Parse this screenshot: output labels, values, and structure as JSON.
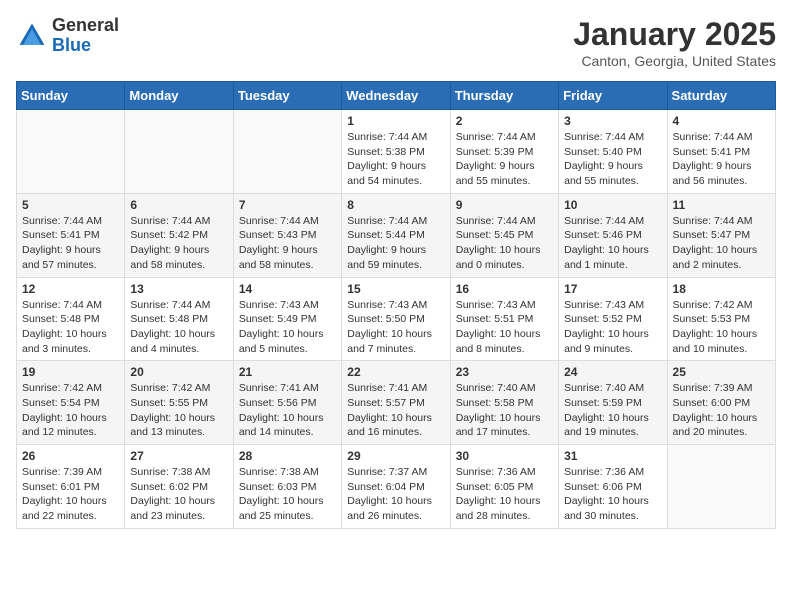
{
  "header": {
    "logo_general": "General",
    "logo_blue": "Blue",
    "month_title": "January 2025",
    "location": "Canton, Georgia, United States"
  },
  "days_of_week": [
    "Sunday",
    "Monday",
    "Tuesday",
    "Wednesday",
    "Thursday",
    "Friday",
    "Saturday"
  ],
  "weeks": [
    [
      {
        "day": "",
        "info": ""
      },
      {
        "day": "",
        "info": ""
      },
      {
        "day": "",
        "info": ""
      },
      {
        "day": "1",
        "info": "Sunrise: 7:44 AM\nSunset: 5:38 PM\nDaylight: 9 hours\nand 54 minutes."
      },
      {
        "day": "2",
        "info": "Sunrise: 7:44 AM\nSunset: 5:39 PM\nDaylight: 9 hours\nand 55 minutes."
      },
      {
        "day": "3",
        "info": "Sunrise: 7:44 AM\nSunset: 5:40 PM\nDaylight: 9 hours\nand 55 minutes."
      },
      {
        "day": "4",
        "info": "Sunrise: 7:44 AM\nSunset: 5:41 PM\nDaylight: 9 hours\nand 56 minutes."
      }
    ],
    [
      {
        "day": "5",
        "info": "Sunrise: 7:44 AM\nSunset: 5:41 PM\nDaylight: 9 hours\nand 57 minutes."
      },
      {
        "day": "6",
        "info": "Sunrise: 7:44 AM\nSunset: 5:42 PM\nDaylight: 9 hours\nand 58 minutes."
      },
      {
        "day": "7",
        "info": "Sunrise: 7:44 AM\nSunset: 5:43 PM\nDaylight: 9 hours\nand 58 minutes."
      },
      {
        "day": "8",
        "info": "Sunrise: 7:44 AM\nSunset: 5:44 PM\nDaylight: 9 hours\nand 59 minutes."
      },
      {
        "day": "9",
        "info": "Sunrise: 7:44 AM\nSunset: 5:45 PM\nDaylight: 10 hours\nand 0 minutes."
      },
      {
        "day": "10",
        "info": "Sunrise: 7:44 AM\nSunset: 5:46 PM\nDaylight: 10 hours\nand 1 minute."
      },
      {
        "day": "11",
        "info": "Sunrise: 7:44 AM\nSunset: 5:47 PM\nDaylight: 10 hours\nand 2 minutes."
      }
    ],
    [
      {
        "day": "12",
        "info": "Sunrise: 7:44 AM\nSunset: 5:48 PM\nDaylight: 10 hours\nand 3 minutes."
      },
      {
        "day": "13",
        "info": "Sunrise: 7:44 AM\nSunset: 5:48 PM\nDaylight: 10 hours\nand 4 minutes."
      },
      {
        "day": "14",
        "info": "Sunrise: 7:43 AM\nSunset: 5:49 PM\nDaylight: 10 hours\nand 5 minutes."
      },
      {
        "day": "15",
        "info": "Sunrise: 7:43 AM\nSunset: 5:50 PM\nDaylight: 10 hours\nand 7 minutes."
      },
      {
        "day": "16",
        "info": "Sunrise: 7:43 AM\nSunset: 5:51 PM\nDaylight: 10 hours\nand 8 minutes."
      },
      {
        "day": "17",
        "info": "Sunrise: 7:43 AM\nSunset: 5:52 PM\nDaylight: 10 hours\nand 9 minutes."
      },
      {
        "day": "18",
        "info": "Sunrise: 7:42 AM\nSunset: 5:53 PM\nDaylight: 10 hours\nand 10 minutes."
      }
    ],
    [
      {
        "day": "19",
        "info": "Sunrise: 7:42 AM\nSunset: 5:54 PM\nDaylight: 10 hours\nand 12 minutes."
      },
      {
        "day": "20",
        "info": "Sunrise: 7:42 AM\nSunset: 5:55 PM\nDaylight: 10 hours\nand 13 minutes."
      },
      {
        "day": "21",
        "info": "Sunrise: 7:41 AM\nSunset: 5:56 PM\nDaylight: 10 hours\nand 14 minutes."
      },
      {
        "day": "22",
        "info": "Sunrise: 7:41 AM\nSunset: 5:57 PM\nDaylight: 10 hours\nand 16 minutes."
      },
      {
        "day": "23",
        "info": "Sunrise: 7:40 AM\nSunset: 5:58 PM\nDaylight: 10 hours\nand 17 minutes."
      },
      {
        "day": "24",
        "info": "Sunrise: 7:40 AM\nSunset: 5:59 PM\nDaylight: 10 hours\nand 19 minutes."
      },
      {
        "day": "25",
        "info": "Sunrise: 7:39 AM\nSunset: 6:00 PM\nDaylight: 10 hours\nand 20 minutes."
      }
    ],
    [
      {
        "day": "26",
        "info": "Sunrise: 7:39 AM\nSunset: 6:01 PM\nDaylight: 10 hours\nand 22 minutes."
      },
      {
        "day": "27",
        "info": "Sunrise: 7:38 AM\nSunset: 6:02 PM\nDaylight: 10 hours\nand 23 minutes."
      },
      {
        "day": "28",
        "info": "Sunrise: 7:38 AM\nSunset: 6:03 PM\nDaylight: 10 hours\nand 25 minutes."
      },
      {
        "day": "29",
        "info": "Sunrise: 7:37 AM\nSunset: 6:04 PM\nDaylight: 10 hours\nand 26 minutes."
      },
      {
        "day": "30",
        "info": "Sunrise: 7:36 AM\nSunset: 6:05 PM\nDaylight: 10 hours\nand 28 minutes."
      },
      {
        "day": "31",
        "info": "Sunrise: 7:36 AM\nSunset: 6:06 PM\nDaylight: 10 hours\nand 30 minutes."
      },
      {
        "day": "",
        "info": ""
      }
    ]
  ]
}
